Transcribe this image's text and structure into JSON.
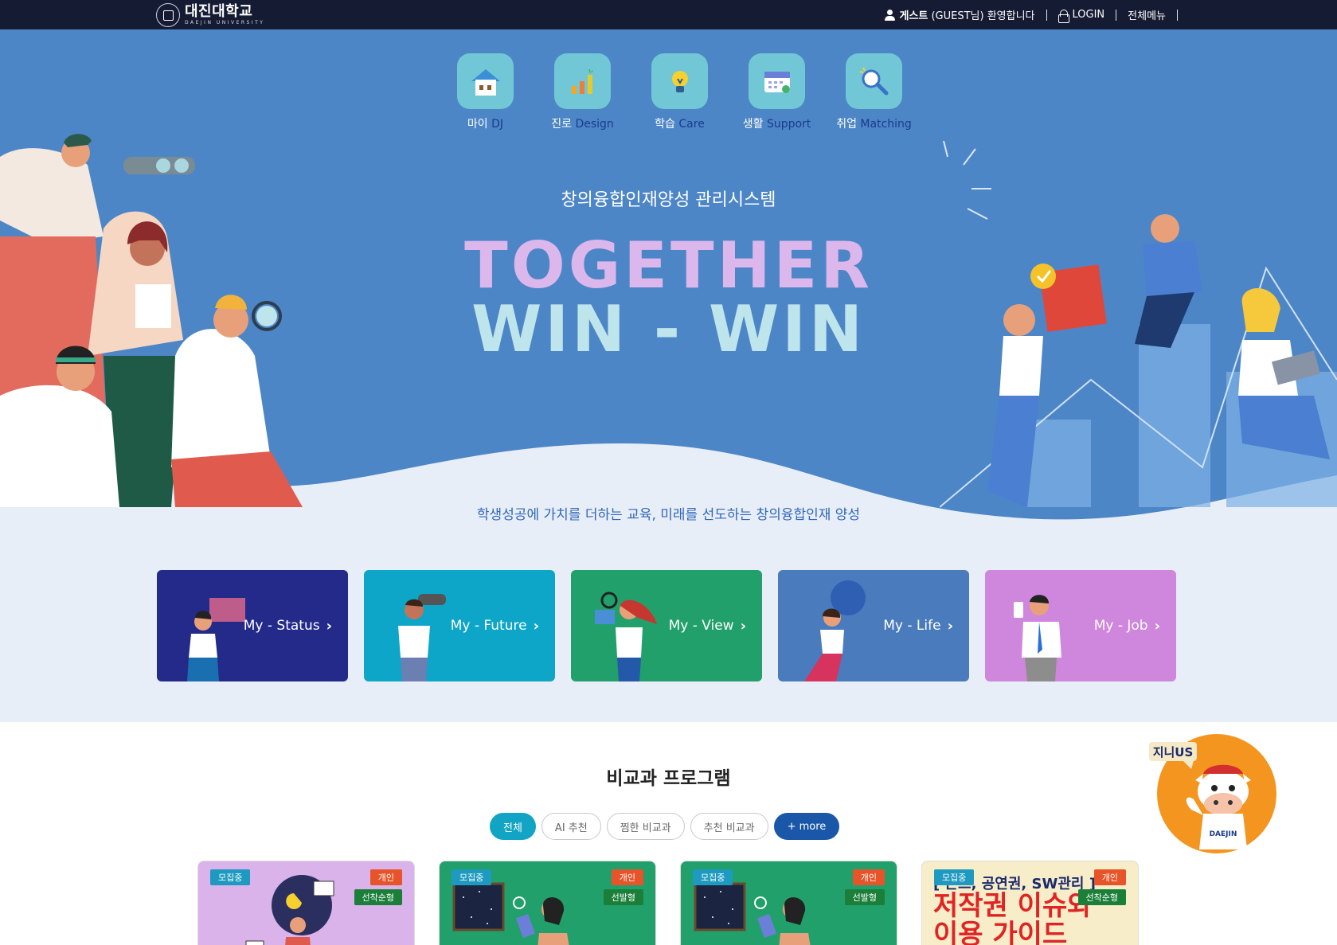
{
  "header": {
    "logo_ko": "대진대학교",
    "logo_en": "DAEJIN UNIVERSITY",
    "greeting_bold": "게스트",
    "greeting_rest": " (GUEST님) 환영합니다",
    "login": "LOGIN",
    "all_menu": "전체메뉴"
  },
  "quick_menu": [
    {
      "ko": "마이",
      "en": "DJ",
      "icon": "house-icon"
    },
    {
      "ko": "진로",
      "en": "Design",
      "icon": "growth-chart-icon"
    },
    {
      "ko": "학습",
      "en": "Care",
      "icon": "lightbulb-icon"
    },
    {
      "ko": "생활",
      "en": "Support",
      "icon": "calendar-icon"
    },
    {
      "ko": "취업",
      "en": "Matching",
      "icon": "magnifier-icon"
    }
  ],
  "hero": {
    "subtitle": "창의융합인재양성 관리시스템",
    "title_line1": "TOGETHER",
    "title_line2": "WIN - WIN",
    "tagline": "학생성공에 가치를 더하는 교육, 미래를 선도하는 창의융합인재 양성"
  },
  "cards": [
    {
      "label": "My - Status",
      "color": "#232a8a"
    },
    {
      "label": "My - Future",
      "color": "#0da6c8"
    },
    {
      "label": "My - View",
      "color": "#22a06b"
    },
    {
      "label": "My - Life",
      "color": "#4a7bbd"
    },
    {
      "label": "My - Job",
      "color": "#cf86dd"
    }
  ],
  "programs": {
    "title": "비교과 프로그램",
    "filters": [
      "전체",
      "AI 추천",
      "찜한 비교과",
      "추천 비교과",
      "+ more"
    ],
    "items": [
      {
        "status": "모집중",
        "type": "개인",
        "method": "선착순형",
        "bg": "#d9b3ea"
      },
      {
        "status": "모집중",
        "type": "개인",
        "method": "선발형",
        "bg": "#22a06b"
      },
      {
        "status": "모집중",
        "type": "개인",
        "method": "선발형",
        "bg": "#22a06b"
      },
      {
        "status": "모집중",
        "type": "개인",
        "method": "선착순형",
        "bg": "#f7edc9",
        "headline1": "[ 폰트, 공연권, SW관리 ]",
        "headline2": "저작권 이슈와",
        "headline3": "이용 가이드"
      }
    ]
  },
  "mascot": {
    "badge": "지니US",
    "shirt": "DAEJIN"
  }
}
